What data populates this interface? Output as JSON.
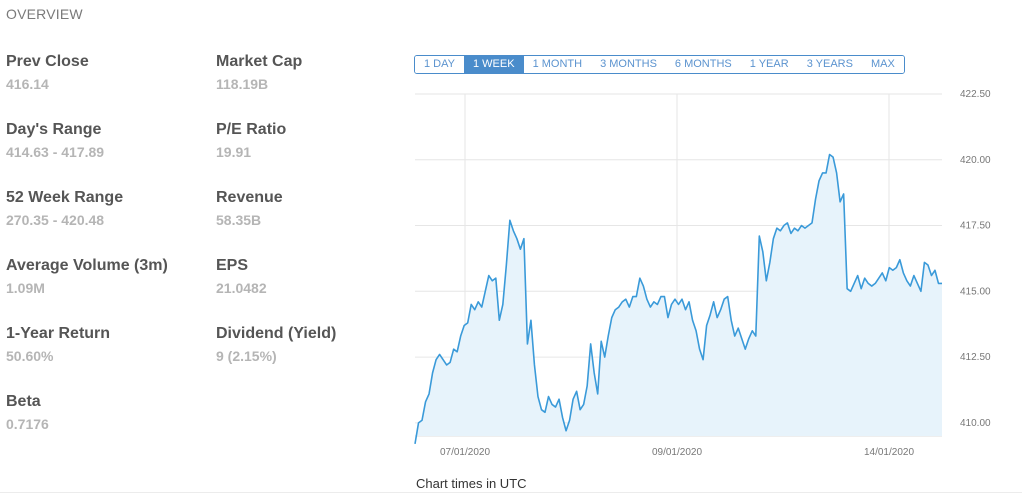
{
  "overview": {
    "title": "OVERVIEW",
    "stats": [
      {
        "label": "Prev Close",
        "value": "416.14"
      },
      {
        "label": "Day's Range",
        "value": "414.63 - 417.89"
      },
      {
        "label": "52 Week Range",
        "value": "270.35 - 420.48"
      },
      {
        "label": "Average Volume (3m)",
        "value": "1.09M"
      },
      {
        "label": "1-Year Return",
        "value": "50.60%"
      },
      {
        "label": "Beta",
        "value": "0.7176"
      },
      {
        "label": "Market Cap",
        "value": "118.19B"
      },
      {
        "label": "P/E Ratio",
        "value": "19.91"
      },
      {
        "label": "Revenue",
        "value": "58.35B"
      },
      {
        "label": "EPS",
        "value": "21.0482"
      },
      {
        "label": "Dividend (Yield)",
        "value": "9 (2.15%)"
      }
    ]
  },
  "range_tabs": {
    "items": [
      "1 DAY",
      "1 WEEK",
      "1 MONTH",
      "3 MONTHS",
      "6 MONTHS",
      "1 YEAR",
      "3 YEARS",
      "MAX"
    ],
    "active": "1 WEEK"
  },
  "footnote": "Chart times in UTC",
  "colors": {
    "line": "#3a9ad9",
    "fill": "#e7f3fb",
    "grid": "#e6e6e6",
    "active_tab": "#4a8ccb"
  },
  "chart_data": {
    "type": "area",
    "ylim": [
      409.5,
      422.5
    ],
    "yticks": [
      "422.50",
      "420.00",
      "417.50",
      "415.00",
      "412.50",
      "410.00"
    ],
    "xticks": [
      "07/01/2020",
      "09/01/2020",
      "14/01/2020"
    ],
    "grid": true,
    "series": [
      {
        "values": [
          409.2,
          410.0,
          410.1,
          410.8,
          411.1,
          411.9,
          412.4,
          412.6,
          412.4,
          412.2,
          412.3,
          412.8,
          412.7,
          413.3,
          413.7,
          413.8,
          414.5,
          414.3,
          414.6,
          414.4,
          415.0,
          415.6,
          415.4,
          415.5,
          413.9,
          414.5,
          416.0,
          417.7,
          417.3,
          417.0,
          416.6,
          417.0,
          413.0,
          413.9,
          412.2,
          411.0,
          410.5,
          410.4,
          411.0,
          410.7,
          410.6,
          410.9,
          410.2,
          409.7,
          410.1,
          410.9,
          411.2,
          410.5,
          410.7,
          411.4,
          413.0,
          411.9,
          411.1,
          413.1,
          412.5,
          413.3,
          414.0,
          414.3,
          414.4,
          414.6,
          414.7,
          414.4,
          414.8,
          414.8,
          415.5,
          415.2,
          414.7,
          414.4,
          414.6,
          414.5,
          414.8,
          414.8,
          414.0,
          414.5,
          414.7,
          414.5,
          414.7,
          414.3,
          414.6,
          413.9,
          413.5,
          412.8,
          412.4,
          413.7,
          414.1,
          414.6,
          414.0,
          414.3,
          414.7,
          414.8,
          413.9,
          413.3,
          413.6,
          413.2,
          412.8,
          413.2,
          413.5,
          413.3,
          417.1,
          416.5,
          415.4,
          416.1,
          417.0,
          417.4,
          417.3,
          417.5,
          417.6,
          417.2,
          417.4,
          417.3,
          417.5,
          417.4,
          417.5,
          417.6,
          418.5,
          419.2,
          419.5,
          419.5,
          420.2,
          420.1,
          419.5,
          418.4,
          418.7,
          415.1,
          415.0,
          415.3,
          415.6,
          415.1,
          415.5,
          415.3,
          415.2,
          415.3,
          415.5,
          415.7,
          415.4,
          415.9,
          415.8,
          415.9,
          416.2,
          415.7,
          415.4,
          415.2,
          415.6,
          415.3,
          415.0,
          416.1,
          416.0,
          415.6,
          415.8,
          415.3,
          415.3
        ]
      }
    ]
  }
}
